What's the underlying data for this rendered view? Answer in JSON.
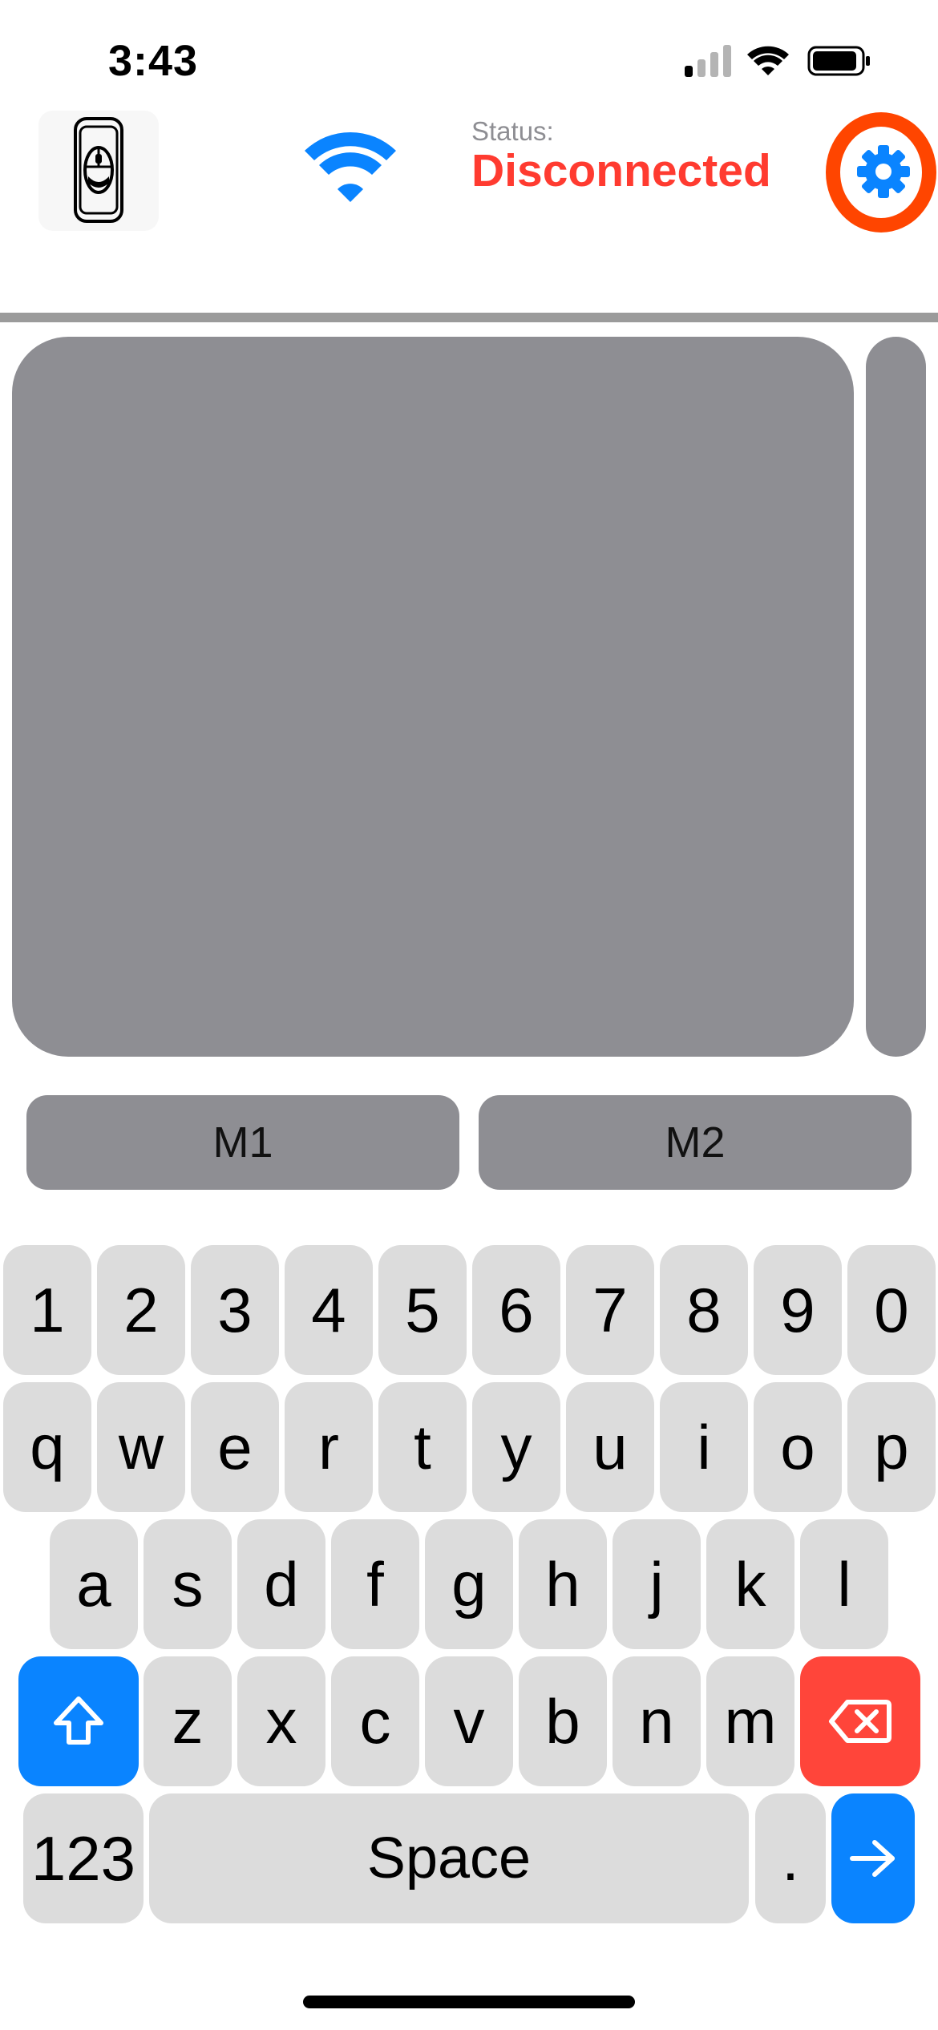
{
  "status_bar": {
    "time": "3:43"
  },
  "header": {
    "status_label": "Status:",
    "status_value": "Disconnected",
    "status_color": "#ff3b30",
    "logo_icon": "phone-mouse-logo-icon",
    "wifi_icon": "wifi-icon",
    "settings_icon": "gear-icon"
  },
  "mouse_buttons": {
    "m1": "M1",
    "m2": "M2"
  },
  "keyboard": {
    "row1": [
      "1",
      "2",
      "3",
      "4",
      "5",
      "6",
      "7",
      "8",
      "9",
      "0"
    ],
    "row2": [
      "q",
      "w",
      "e",
      "r",
      "t",
      "y",
      "u",
      "i",
      "o",
      "p"
    ],
    "row3": [
      "a",
      "s",
      "d",
      "f",
      "g",
      "h",
      "j",
      "k",
      "l"
    ],
    "row4": [
      "z",
      "x",
      "c",
      "v",
      "b",
      "n",
      "m"
    ],
    "numbers_key": "123",
    "space_key": "Space",
    "period_key": ".",
    "shift_icon": "shift-arrow-icon",
    "delete_icon": "delete-backspace-icon",
    "return_icon": "arrow-right-icon",
    "accent_blue": "#0a84ff",
    "accent_red": "#ff453a"
  }
}
